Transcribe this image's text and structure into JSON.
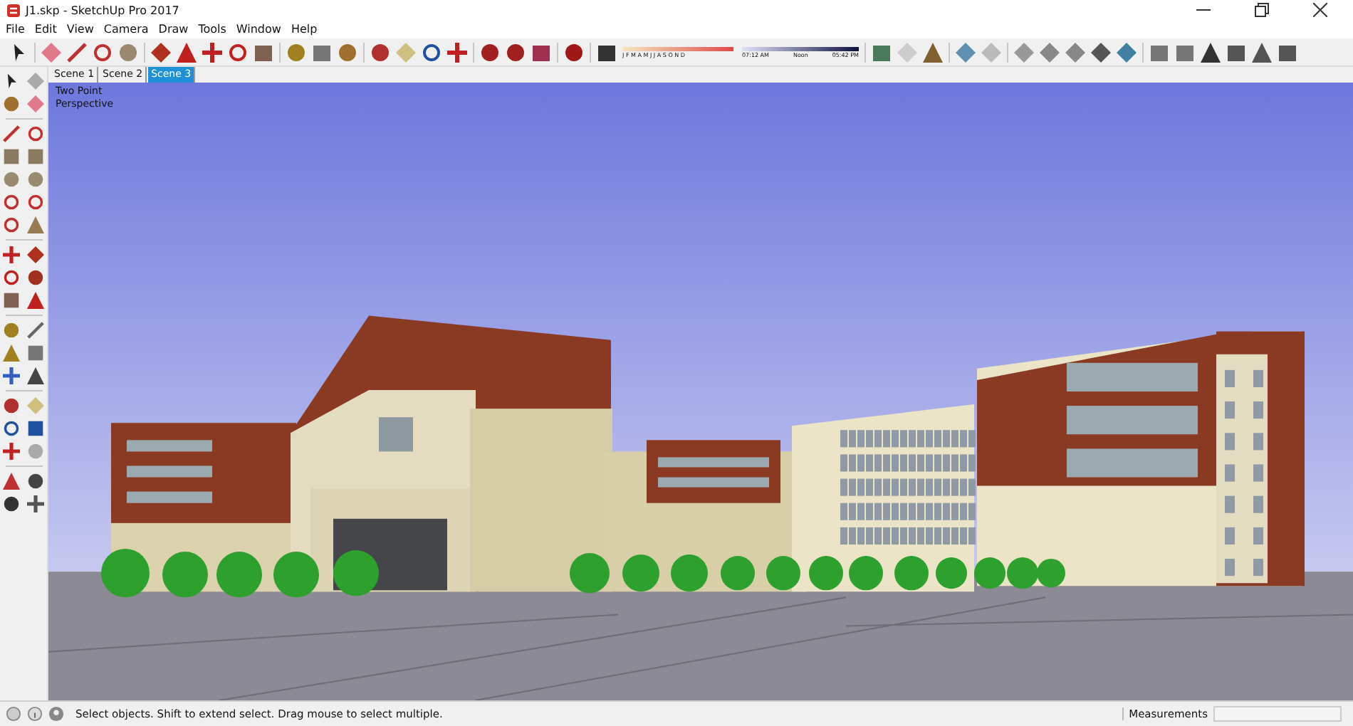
{
  "window": {
    "title": "J1.skp - SketchUp Pro 2017"
  },
  "menu": [
    "File",
    "Edit",
    "View",
    "Camera",
    "Draw",
    "Tools",
    "Window",
    "Help"
  ],
  "shadow_settings": {
    "months": "J F M A M J J A S O N D",
    "time_start": "07:12 AM",
    "time_mid": "Noon",
    "time_end": "05:42 PM"
  },
  "scene_tabs": [
    {
      "label": "Scene 1",
      "selected": false
    },
    {
      "label": "Scene 2",
      "selected": false
    },
    {
      "label": "Scene 3",
      "selected": true
    }
  ],
  "viewport": {
    "camera_label": "Two Point Perspective"
  },
  "status_bar": {
    "message": "Select objects. Shift to extend select. Drag mouse to select multiple.",
    "measurements_label": "Measurements"
  }
}
